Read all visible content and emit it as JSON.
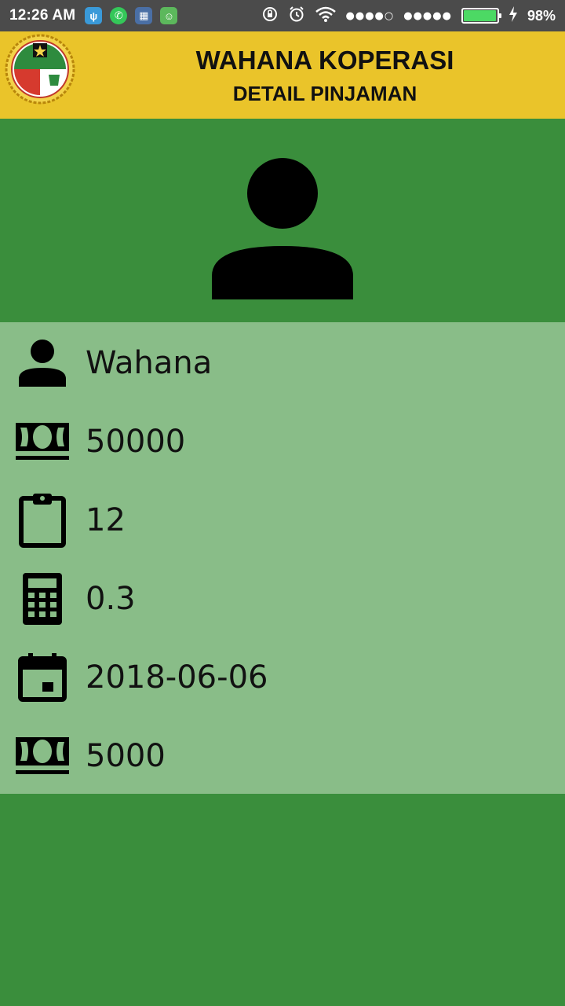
{
  "status_bar": {
    "time": "12:26 AM",
    "notifications": [
      "usb-icon",
      "whatsapp-icon",
      "bbm-icon",
      "android-icon"
    ],
    "signal1": "●●●●○",
    "signal2": "●●●●●",
    "battery_level": 0.98,
    "battery_text": "98%",
    "battery_color": "#4cd964"
  },
  "header": {
    "title": "WAHANA KOPERASI",
    "subtitle": "DETAIL PINJAMAN",
    "background": "#eac42a"
  },
  "details": {
    "name": "Wahana",
    "amount": "50000",
    "tenor": "12",
    "interest": "0.3",
    "date": "2018-06-06",
    "installment": "5000"
  },
  "colors": {
    "primary_green": "#3a8e3c",
    "light_green": "#89bd88"
  }
}
